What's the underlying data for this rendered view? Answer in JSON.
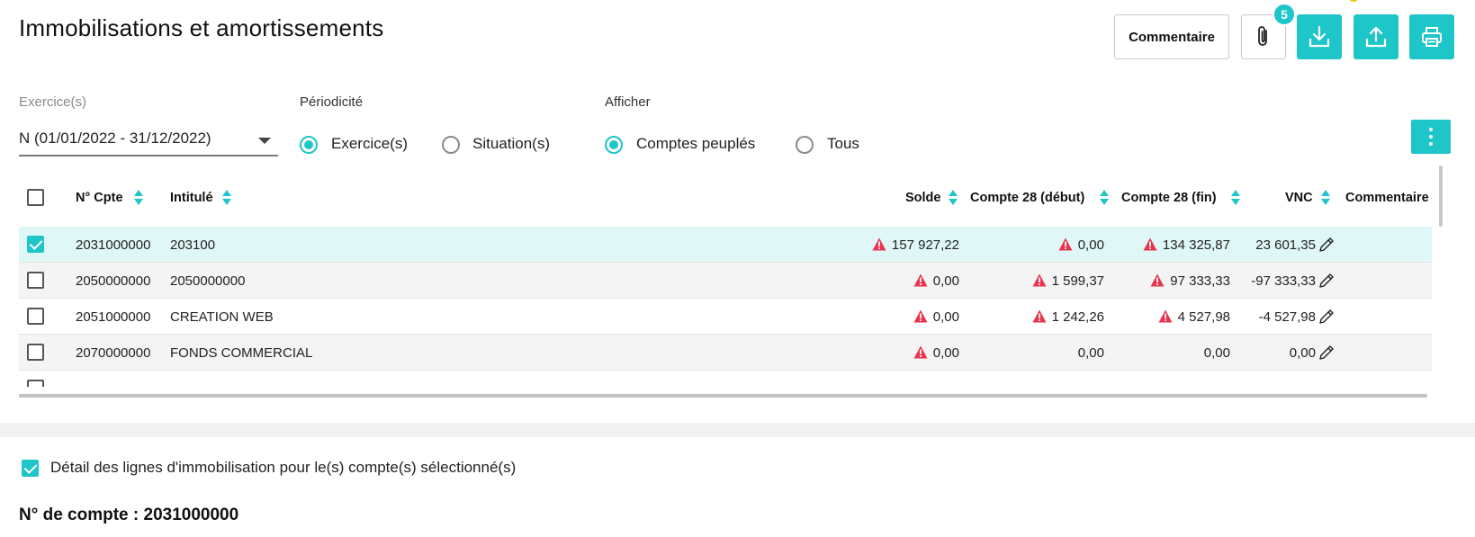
{
  "page": {
    "title": "Immobilisations et amortissements"
  },
  "toolbar": {
    "comment_label": "Commentaire",
    "attachments_count": "5",
    "icons": [
      "paperclip-icon",
      "download-icon",
      "upload-icon",
      "printer-icon"
    ],
    "accent_color": "#1ec5c9"
  },
  "filters": {
    "exercice_label": "Exercice(s)",
    "exercice_value": "N (01/01/2022 - 31/12/2022)",
    "periodicite_label": "Périodicité",
    "periodicite_options": [
      {
        "label": "Exercice(s)",
        "selected": true
      },
      {
        "label": "Situation(s)",
        "selected": false
      }
    ],
    "afficher_label": "Afficher",
    "afficher_options": [
      {
        "label": "Comptes peuplés",
        "selected": true
      },
      {
        "label": "Tous",
        "selected": false
      }
    ]
  },
  "table": {
    "columns": [
      "N° Cpte",
      "Intitulé",
      "Solde",
      "Compte 28 (début)",
      "Compte 28 (fin)",
      "VNC",
      "Commentaire"
    ],
    "rows": [
      {
        "checked": true,
        "account": "2031000000",
        "label": "203100",
        "solde": "157 927,22",
        "solde_warn": true,
        "c28_debut": "0,00",
        "c28_debut_warn": true,
        "c28_fin": "134 325,87",
        "c28_fin_warn": true,
        "vnc": "23 601,35"
      },
      {
        "checked": false,
        "account": "2050000000",
        "label": "2050000000",
        "solde": "0,00",
        "solde_warn": true,
        "c28_debut": "1 599,37",
        "c28_debut_warn": true,
        "c28_fin": "97 333,33",
        "c28_fin_warn": true,
        "vnc": "-97 333,33"
      },
      {
        "checked": false,
        "account": "2051000000",
        "label": "CREATION WEB",
        "solde": "0,00",
        "solde_warn": true,
        "c28_debut": "1 242,26",
        "c28_debut_warn": true,
        "c28_fin": "4 527,98",
        "c28_fin_warn": true,
        "vnc": "-4 527,98"
      },
      {
        "checked": false,
        "account": "2070000000",
        "label": "FONDS COMMERCIAL",
        "solde": "0,00",
        "solde_warn": true,
        "c28_debut": "0,00",
        "c28_debut_warn": false,
        "c28_fin": "0,00",
        "c28_fin_warn": false,
        "vnc": "0,00"
      }
    ],
    "warning_color": "#e8344e"
  },
  "detail": {
    "checkbox_label": "Détail des lignes d'immobilisation pour le(s) compte(s) sélectionné(s)",
    "checked": true,
    "account_title": "N° de compte : 2031000000"
  }
}
